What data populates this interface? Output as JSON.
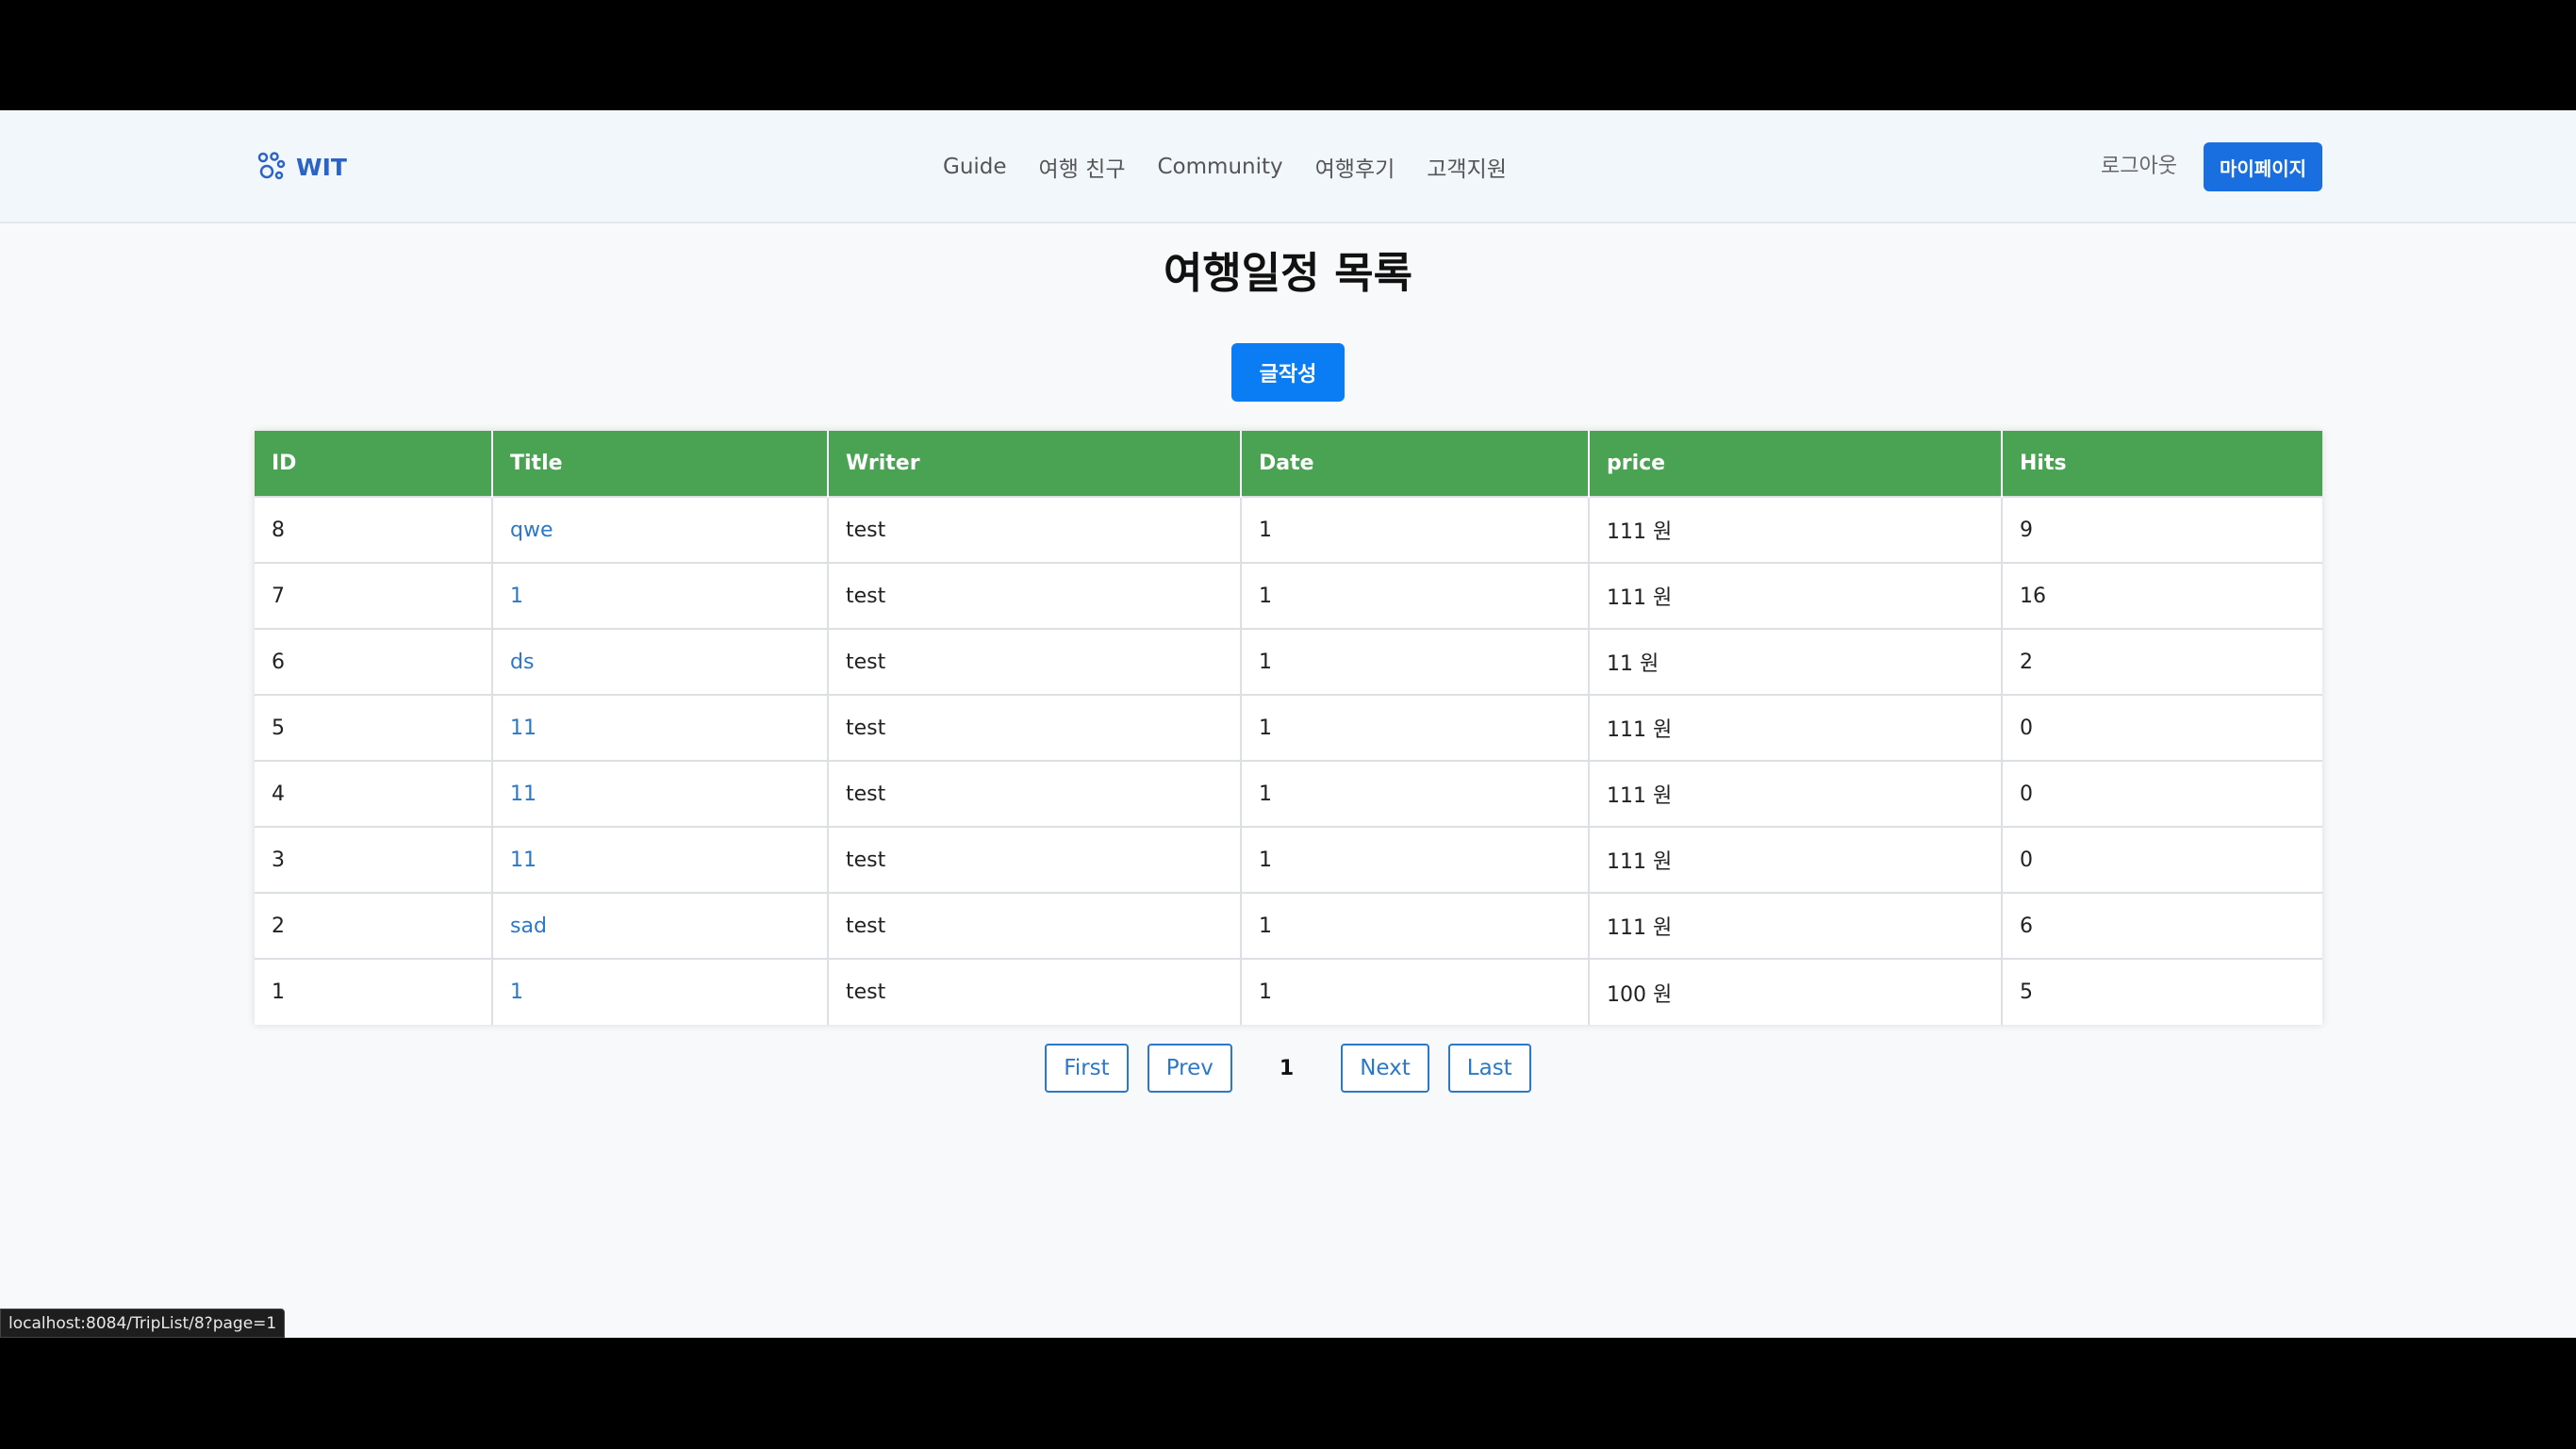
{
  "header": {
    "logo": "WIT",
    "nav": [
      "Guide",
      "여행 친구",
      "Community",
      "여행후기",
      "고객지원"
    ],
    "logout": "로그아웃",
    "mypage": "마이페이지"
  },
  "main": {
    "title": "여행일정 목록",
    "write_button": "글작성"
  },
  "table": {
    "columns": [
      "ID",
      "Title",
      "Writer",
      "Date",
      "price",
      "Hits"
    ],
    "rows": [
      {
        "id": "8",
        "title": "qwe",
        "writer": "test",
        "date": "1",
        "price": "111 원",
        "hits": "9"
      },
      {
        "id": "7",
        "title": "1",
        "writer": "test",
        "date": "1",
        "price": "111 원",
        "hits": "16"
      },
      {
        "id": "6",
        "title": "ds",
        "writer": "test",
        "date": "1",
        "price": "11 원",
        "hits": "2"
      },
      {
        "id": "5",
        "title": "11",
        "writer": "test",
        "date": "1",
        "price": "111 원",
        "hits": "0"
      },
      {
        "id": "4",
        "title": "11",
        "writer": "test",
        "date": "1",
        "price": "111 원",
        "hits": "0"
      },
      {
        "id": "3",
        "title": "11",
        "writer": "test",
        "date": "1",
        "price": "111 원",
        "hits": "0"
      },
      {
        "id": "2",
        "title": "sad",
        "writer": "test",
        "date": "1",
        "price": "111 원",
        "hits": "6"
      },
      {
        "id": "1",
        "title": "1",
        "writer": "test",
        "date": "1",
        "price": "100 원",
        "hits": "5"
      }
    ]
  },
  "pagination": {
    "first": "First",
    "prev": "Prev",
    "current": "1",
    "next": "Next",
    "last": "Last"
  },
  "status_url": "localhost:8084/TripList/8?page=1",
  "colors": {
    "accent": "#1a6fe0",
    "table_header": "#4aa352",
    "link": "#2b78c9"
  },
  "icons": {
    "logo": "paw-icon"
  }
}
